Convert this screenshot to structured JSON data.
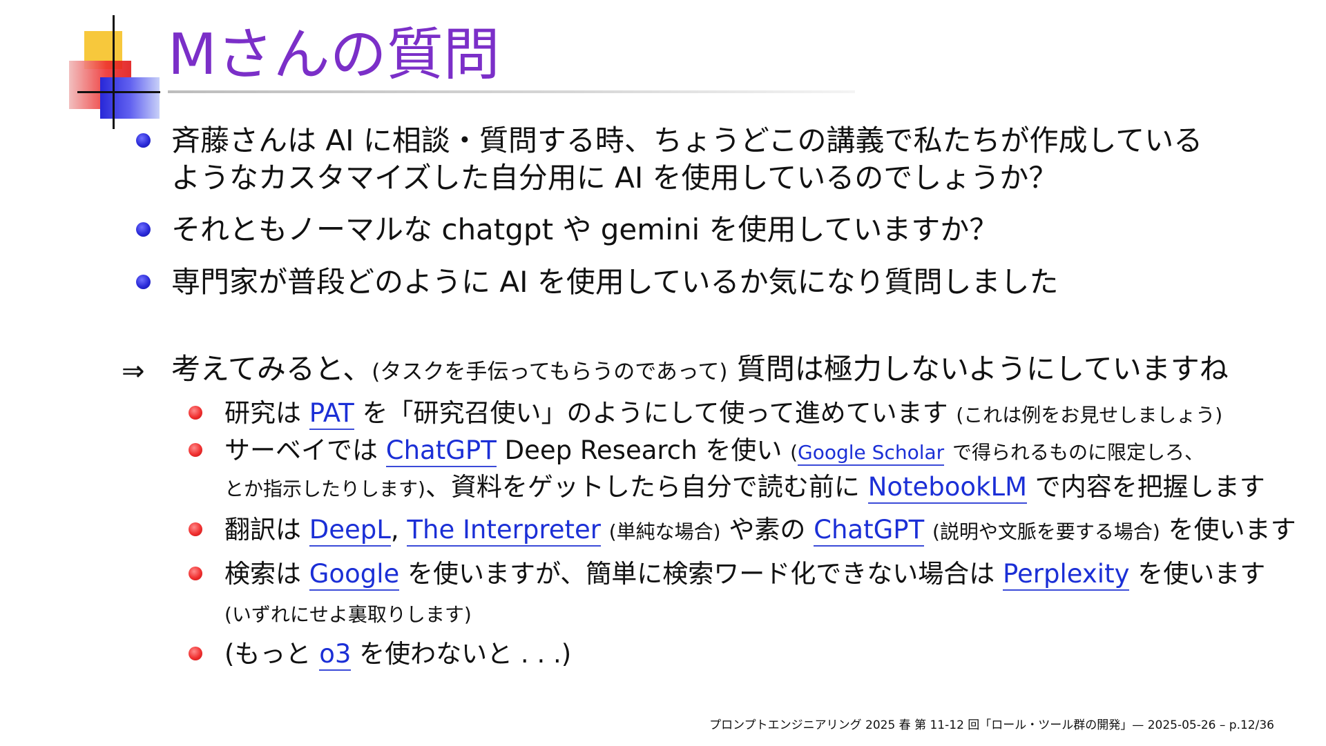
{
  "title": "Mさんの質問",
  "bullets": [
    {
      "line1": "斉藤さんは AI に相談・質問する時、ちょうどこの講義で私たちが作成している",
      "line2": "ようなカスタマイズした自分用に AI を使用しているのでしょうか？"
    },
    {
      "text": "それともノーマルな chatgpt や gemini を使用していますか？"
    },
    {
      "text": "専門家が普段どのように AI を使用しているか気になり質問しました"
    }
  ],
  "answer": {
    "arrow": "⇒",
    "text_main_a": "考えてみると、",
    "text_small": "(タスクを手伝ってもらうのであって)",
    "text_main_b": "質問は極力しないようにしていますね"
  },
  "sub_bullets": {
    "research": {
      "a": "研究は",
      "link": "PAT",
      "b": "を「研究召使い」のようにして使って進めています",
      "note": "(これは例をお見せしましょう)"
    },
    "survey": {
      "a": "サーベイでは",
      "link1": "ChatGPT",
      "b": "Deep Research を使い",
      "paren_open": "(",
      "link2": "Google Scholar",
      "c": "で得られるものに限定しろ、",
      "d": "とか指示したりします)",
      "e": "、資料をゲットしたら自分で読む前に",
      "link3": "NotebookLM",
      "f": "で内容を把握します"
    },
    "translation": {
      "a": "翻訳は",
      "link1": "DeepL",
      "comma": ",",
      "link2": "The Interpreter",
      "note1": "(単純な場合)",
      "b": "や素の",
      "link3": "ChatGPT",
      "note2": "(説明や文脈を要する場合)",
      "c": "を使います"
    },
    "search": {
      "a": "検索は",
      "link1": "Google",
      "b": "を使いますが、簡単に検索ワード化できない場合は",
      "link2": "Perplexity",
      "c": "を使います",
      "note": "(いずれにせよ裏取りします)"
    },
    "o3": {
      "a": "(もっと",
      "link": "o3",
      "b": "を使わないと . . .)"
    }
  },
  "footer": "プロンプトエンジニアリング 2025 春 第 11-12 回「ロール・ツール群の開発」— 2025-05-26 – p.12/36",
  "colors": {
    "title": "#7b2fc8",
    "link": "#1b2fd6",
    "bullet_main": "#2a2ad8",
    "bullet_sub": "#f03030"
  }
}
